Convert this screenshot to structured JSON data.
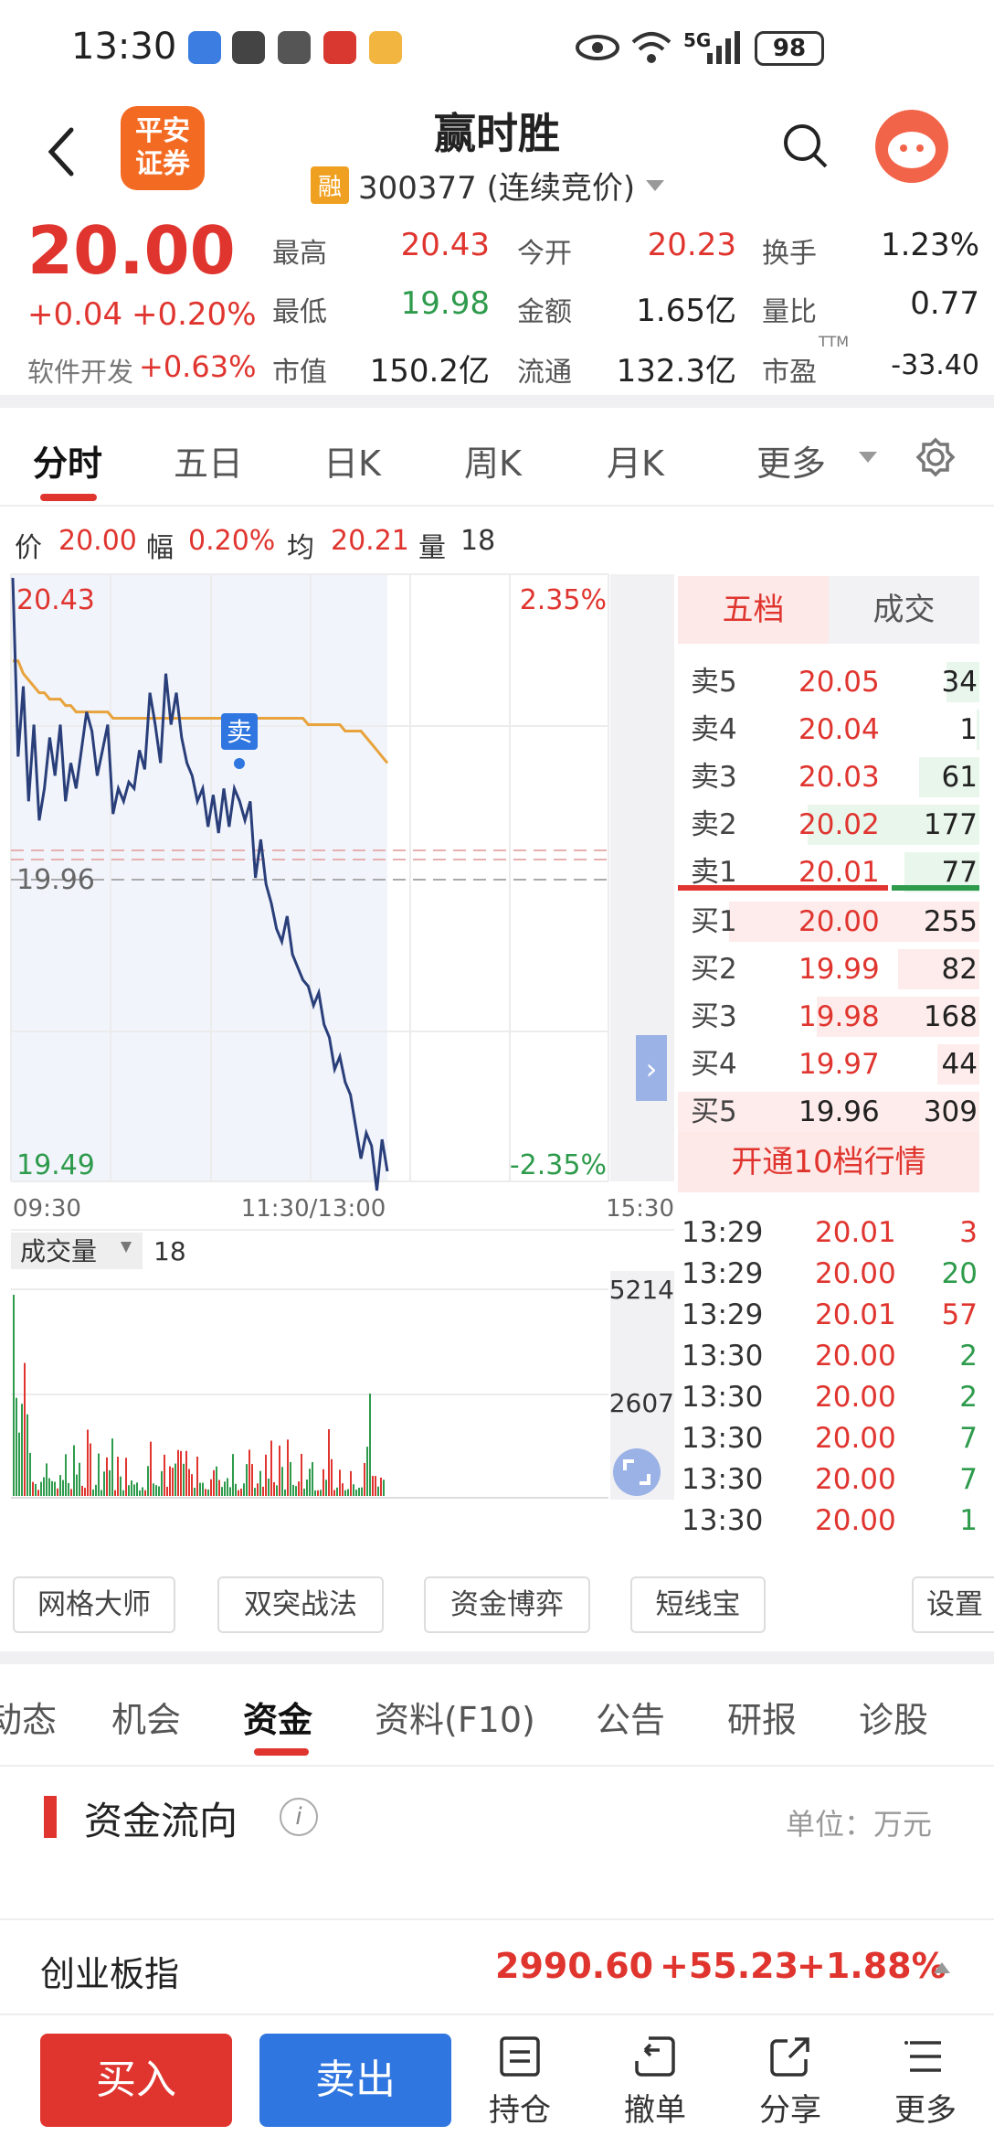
{
  "status_bar": {
    "time": "13:30",
    "network": "5G",
    "battery": "98"
  },
  "header": {
    "title": "赢时胜",
    "logo_text": "平安证券",
    "tag": "融",
    "code_line": "300377 (连续竞价)"
  },
  "quote": {
    "price": "20.00",
    "change": "+0.04",
    "change_pct": "+0.20%",
    "sector": "软件开发",
    "sector_pct": "+0.63%",
    "high_label": "最高",
    "high": "20.43",
    "open_label": "今开",
    "open": "20.23",
    "turnover_label": "换手",
    "turnover": "1.23%",
    "low_label": "最低",
    "low": "19.98",
    "amount_label": "金额",
    "amount": "1.65亿",
    "vol_ratio_label": "量比",
    "vol_ratio": "0.77",
    "mcap_label": "市值",
    "mcap": "150.2亿",
    "float_label": "流通",
    "float": "132.3亿",
    "pe_label": "市盈",
    "pe_sup": "TTM",
    "pe": "-33.40"
  },
  "chart_tabs": [
    "分时",
    "五日",
    "日K",
    "周K",
    "月K",
    "更多"
  ],
  "chart_info": {
    "price_label": "价",
    "price": "20.00",
    "pct_label": "幅",
    "pct": "0.20%",
    "avg_label": "均",
    "avg": "20.21",
    "vol_label": "量",
    "vol": "18"
  },
  "chart_data": {
    "type": "line",
    "y_top": "20.43",
    "y_top_pct": "2.35%",
    "y_mid": "19.96",
    "y_bottom": "19.49",
    "y_bottom_pct": "-2.35%",
    "ylim": [
      19.49,
      20.43
    ],
    "x_labels": [
      "09:30",
      "11:30/13:00",
      "15:30"
    ],
    "marker_label": "卖",
    "series": [
      {
        "values": [
          20.43,
          20.15,
          20.26,
          20.08,
          20.2,
          20.05,
          20.1,
          20.18,
          20.12,
          20.2,
          20.08,
          20.14,
          20.1,
          20.16,
          20.22,
          20.19,
          20.12,
          20.16,
          20.2,
          20.06,
          20.1,
          20.08,
          20.11,
          20.1,
          20.16,
          20.13,
          20.25,
          20.2,
          20.14,
          20.28,
          20.2,
          20.25,
          20.18,
          20.14,
          20.12,
          20.08,
          20.1,
          20.04,
          20.09,
          20.03,
          20.1,
          20.04,
          20.1,
          20.08,
          20.05,
          20.08,
          19.96,
          20.02,
          19.95,
          19.92,
          19.88,
          19.86,
          19.9,
          19.84,
          19.82,
          19.8,
          19.79,
          19.76,
          19.78,
          19.73,
          19.71,
          19.66,
          19.68,
          19.64,
          19.62,
          19.57,
          19.52,
          19.56,
          19.54,
          19.47,
          19.55,
          19.5
        ]
      },
      {
        "values": [
          20.3,
          20.3,
          20.28,
          20.27,
          20.26,
          20.25,
          20.25,
          20.24,
          20.24,
          20.24,
          20.23,
          20.23,
          20.22,
          20.22,
          20.22,
          20.22,
          20.22,
          20.22,
          20.22,
          20.21,
          20.21,
          20.21,
          20.21,
          20.21,
          20.21,
          20.21,
          20.21,
          20.21,
          20.21,
          20.21,
          20.21,
          20.21,
          20.21,
          20.21,
          20.21,
          20.21,
          20.21,
          20.21,
          20.21,
          20.21,
          20.21,
          20.21,
          20.21,
          20.21,
          20.21,
          20.21,
          20.21,
          20.21,
          20.21,
          20.21,
          20.21,
          20.21,
          20.21,
          20.21,
          20.21,
          20.21,
          20.2,
          20.2,
          20.2,
          20.2,
          20.2,
          20.2,
          20.2,
          20.19,
          20.19,
          20.19,
          20.19,
          20.18,
          20.17,
          20.16,
          20.15,
          20.14
        ]
      }
    ]
  },
  "volume": {
    "label": "成交量",
    "value": "18",
    "top_tick": "5214",
    "mid_tick": "2607"
  },
  "depth": {
    "tab_active": "五档",
    "tab_other": "成交",
    "asks": [
      {
        "label": "卖5",
        "price": "20.05",
        "vol": "34",
        "fill": 0.11
      },
      {
        "label": "卖4",
        "price": "20.04",
        "vol": "1",
        "fill": 0.01
      },
      {
        "label": "卖3",
        "price": "20.03",
        "vol": "61",
        "fill": 0.2
      },
      {
        "label": "卖2",
        "price": "20.02",
        "vol": "177",
        "fill": 0.57
      },
      {
        "label": "卖1",
        "price": "20.01",
        "vol": "77",
        "fill": 0.25
      }
    ],
    "bids": [
      {
        "label": "买1",
        "price": "20.00",
        "vol": "255",
        "fill": 0.83
      },
      {
        "label": "买2",
        "price": "19.99",
        "vol": "82",
        "fill": 0.27
      },
      {
        "label": "买3",
        "price": "19.98",
        "vol": "168",
        "fill": 0.54
      },
      {
        "label": "买4",
        "price": "19.97",
        "vol": "44",
        "fill": 0.14
      },
      {
        "label": "买5",
        "price": "19.96",
        "vol": "309",
        "fill": 1.0
      }
    ],
    "open10": "开通10档行情"
  },
  "ticks": [
    {
      "t": "13:29",
      "p": "20.01",
      "v": "3",
      "pc": "red",
      "vc": "red"
    },
    {
      "t": "13:29",
      "p": "20.00",
      "v": "20",
      "pc": "red",
      "vc": "green"
    },
    {
      "t": "13:29",
      "p": "20.01",
      "v": "57",
      "pc": "red",
      "vc": "red"
    },
    {
      "t": "13:30",
      "p": "20.00",
      "v": "2",
      "pc": "red",
      "vc": "green"
    },
    {
      "t": "13:30",
      "p": "20.00",
      "v": "2",
      "pc": "red",
      "vc": "green"
    },
    {
      "t": "13:30",
      "p": "20.00",
      "v": "7",
      "pc": "red",
      "vc": "green"
    },
    {
      "t": "13:30",
      "p": "20.00",
      "v": "7",
      "pc": "red",
      "vc": "green"
    },
    {
      "t": "13:30",
      "p": "20.00",
      "v": "1",
      "pc": "red",
      "vc": "green"
    }
  ],
  "tools": [
    "网格大师",
    "双突战法",
    "资金博弈",
    "短线宝",
    "设置"
  ],
  "info_tabs": [
    "动态",
    "机会",
    "资金",
    "资料(F10)",
    "公告",
    "研报",
    "诊股"
  ],
  "fund_flow": {
    "title": "资金流向",
    "unit": "单位：万元"
  },
  "index_bar": {
    "name": "创业板指",
    "value": "2990.60",
    "change": "+55.23",
    "pct": "+1.88%"
  },
  "actions": {
    "buy": "买入",
    "sell": "卖出",
    "hold": "持仓",
    "cancel": "撤单",
    "share": "分享",
    "more": "更多"
  },
  "colors": {
    "red": "#e0352f",
    "green": "#2e9b4c",
    "blue": "#2f76e0",
    "avg_line": "#e8a33c",
    "price_line": "#2a3f7a"
  }
}
